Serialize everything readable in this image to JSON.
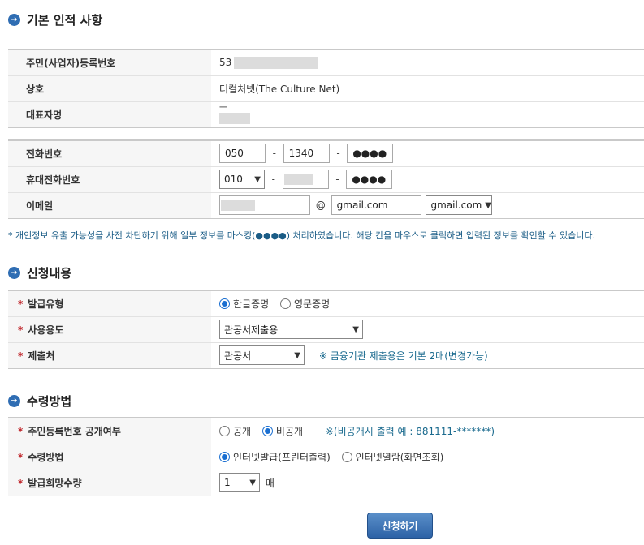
{
  "sections": {
    "basic_info": "기본 인적 사항",
    "application": "신청내용",
    "receipt": "수령방법"
  },
  "basic": {
    "reg_no_label": "주민(사업자)등록번호",
    "reg_no_value": "53",
    "company_label": "상호",
    "company_value": "더컬처넷(The Culture Net)",
    "ceo_label": "대표자명",
    "ceo_value": "一"
  },
  "contact": {
    "phone_label": "전화번호",
    "phone_1": "050",
    "phone_2": "1340",
    "phone_3": "●●●●",
    "mobile_label": "휴대전화번호",
    "mobile_1": "010",
    "mobile_3": "●●●●",
    "email_label": "이메일",
    "email_at": "@",
    "email_domain": "gmail.com",
    "email_domain_select": "gmail.com",
    "dash": "-"
  },
  "notice": "* 개인정보 유출 가능성을 사전 차단하기 위해 일부 정보를 마스킹(●●●●) 처리하였습니다. 해당 칸을 마우스로 클릭하면 입력된 정보를 확인할 수 있습니다.",
  "application": {
    "issue_type_label": "발급유형",
    "issue_korean": "한글증명",
    "issue_english": "영문증명",
    "purpose_label": "사용용도",
    "purpose_value": "관공서제출용",
    "submit_to_label": "제출처",
    "submit_to_value": "관공서",
    "submit_to_note": "※ 금융기관 제출용은 기본 2매(변경가능)"
  },
  "receipt": {
    "disclose_label": "주민등록번호 공개여부",
    "disclose_public": "공개",
    "disclose_private": "비공개",
    "disclose_note": "※(비공개시 출력 예 : 881111-*******)",
    "method_label": "수령방법",
    "method_internet_issue": "인터넷발급(프린터출력)",
    "method_internet_view": "인터넷열람(화면조회)",
    "quantity_label": "발급희망수량",
    "quantity_value": "1",
    "quantity_unit": "매"
  },
  "required_mark": "*",
  "submit_label": "신청하기"
}
